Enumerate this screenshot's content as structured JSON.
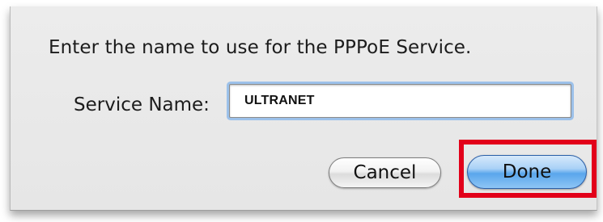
{
  "dialog": {
    "prompt": "Enter the name to use for the PPPoE Service.",
    "service_name_label": "Service Name:",
    "service_name_value": "ULTRANET",
    "cancel_label": "Cancel",
    "done_label": "Done"
  },
  "colors": {
    "sheet_background": "#e8e8e8",
    "focus_ring": "#9cc1ea",
    "default_button": "#5aa6ec",
    "highlight_box": "#e2001a"
  }
}
